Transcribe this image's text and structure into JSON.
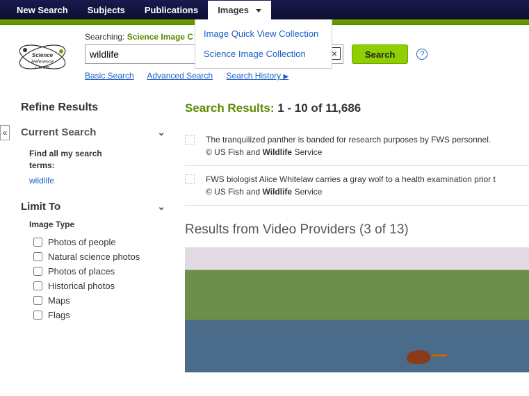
{
  "topnav": {
    "new_search": "New Search",
    "subjects": "Subjects",
    "publications": "Publications",
    "images": "Images"
  },
  "dropdown": {
    "quick_view": "Image Quick View Collection",
    "science_image": "Science Image Collection"
  },
  "search": {
    "searching_label": "Searching:",
    "db_name": "Science Image C",
    "input_value": "wildlife",
    "button_label": "Search",
    "basic": "Basic Search",
    "advanced": "Advanced Search",
    "history": "Search History"
  },
  "sidebar": {
    "refine": "Refine Results",
    "current_search": "Current Search",
    "find_all_label_1": "Find all my search",
    "find_all_label_2": "terms:",
    "term": "wildlife",
    "limit_to": "Limit To",
    "image_type": "Image Type",
    "facets": {
      "people": "Photos of people",
      "natural": "Natural science photos",
      "places": "Photos of places",
      "historical": "Historical photos",
      "maps": "Maps",
      "flags": "Flags"
    }
  },
  "results": {
    "label": "Search Results:",
    "range": "1 - 10 of 11,686",
    "r1_a": "The tranquilized panther is banded for research purposes by FWS personnel. ",
    "r1_b": "© US Fish and ",
    "r1_bold": "Wildlife",
    "r1_c": " Service",
    "r2_a": "FWS biologist Alice Whitelaw carries a gray wolf to a health examination prior t",
    "r2_b": "© US Fish and ",
    "r2_bold": "Wildlife",
    "r2_c": " Service",
    "video_head": "Results from Video Providers (3 of 13)"
  }
}
